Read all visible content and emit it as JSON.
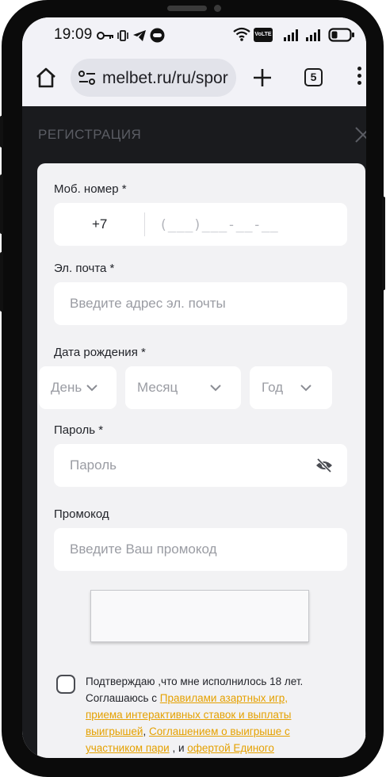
{
  "status_bar": {
    "time": "19:09",
    "volte_label": "VoLTE",
    "battery": "low"
  },
  "browser": {
    "url": "melbet.ru/ru/spor",
    "tab_count": "5"
  },
  "header": {
    "title": "РЕГИСТРАЦИЯ"
  },
  "form": {
    "phone": {
      "label": "Моб. номер *",
      "country_code": "+7",
      "mask": "(___)___-__-__"
    },
    "email": {
      "label": "Эл. почта *",
      "placeholder": "Введите адрес эл. почты"
    },
    "birth_date": {
      "label": "Дата рождения *",
      "day": "День",
      "month": "Месяц",
      "year": "Год"
    },
    "password": {
      "label": "Пароль *",
      "placeholder": "Пароль"
    },
    "promo": {
      "label": "Промокод",
      "placeholder": "Введите Ваш промокод"
    },
    "terms": {
      "text_1": "Подтверждаю ,что мне исполнилось 18 лет. Соглашаюсь с ",
      "link_1": "Правилами азартных игр, приема интерактивных ставок и выплаты выигрышей",
      "text_2": ", ",
      "link_2": "Соглашением о выигрыше с участником пари",
      "text_3": " , и ",
      "link_3": "офертой Единого"
    }
  },
  "colors": {
    "accent_link": "#e5a100",
    "header_bg": "#1a1b1e",
    "card_bg": "#f2f2f4"
  }
}
